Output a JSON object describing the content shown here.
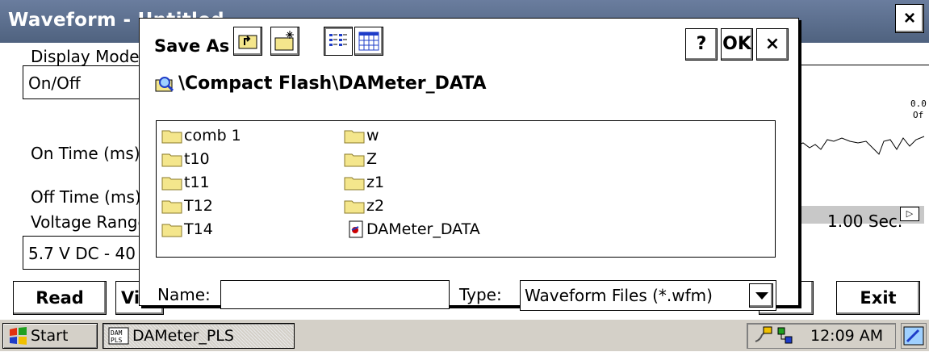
{
  "window": {
    "title": "Waveform - Untitled",
    "close_label": "×"
  },
  "form": {
    "display_mode_label": "Display Mode:",
    "display_mode_value": "On/Off",
    "on_time_label": "On Time (ms)",
    "off_time_label": "Off Time (ms)",
    "voltage_range_label": "Voltage Range",
    "voltage_range_value": "5.7 V DC - 40"
  },
  "chart": {
    "value_label": "0.0",
    "value_sublabel": "Of",
    "time_label": "1.00 Sec."
  },
  "buttons": {
    "read": "Read",
    "view": "Vi",
    "exit": "Exit"
  },
  "dialog": {
    "title": "Save As",
    "help_label": "?",
    "ok_label": "OK",
    "close_label": "×",
    "path": "\\Compact Flash\\DAMeter_DATA",
    "files_col1": [
      "comb 1",
      "t10",
      "t11",
      "T12",
      "T14"
    ],
    "files_col2": [
      "w",
      "Z",
      "z1",
      "z2"
    ],
    "file_item": "DAMeter_DATA",
    "name_label": "Name:",
    "name_value": "",
    "type_label": "Type:",
    "type_value": "Waveform Files (*.wfm)"
  },
  "taskbar": {
    "start_label": "Start",
    "task_label": "DAMeter_PLS",
    "clock": "12:09 AM"
  },
  "icons": {
    "toolbar": [
      "up-folder-icon",
      "new-folder-icon",
      "list-view-icon",
      "detail-view-icon"
    ],
    "folder_color": "#f4e68c"
  }
}
